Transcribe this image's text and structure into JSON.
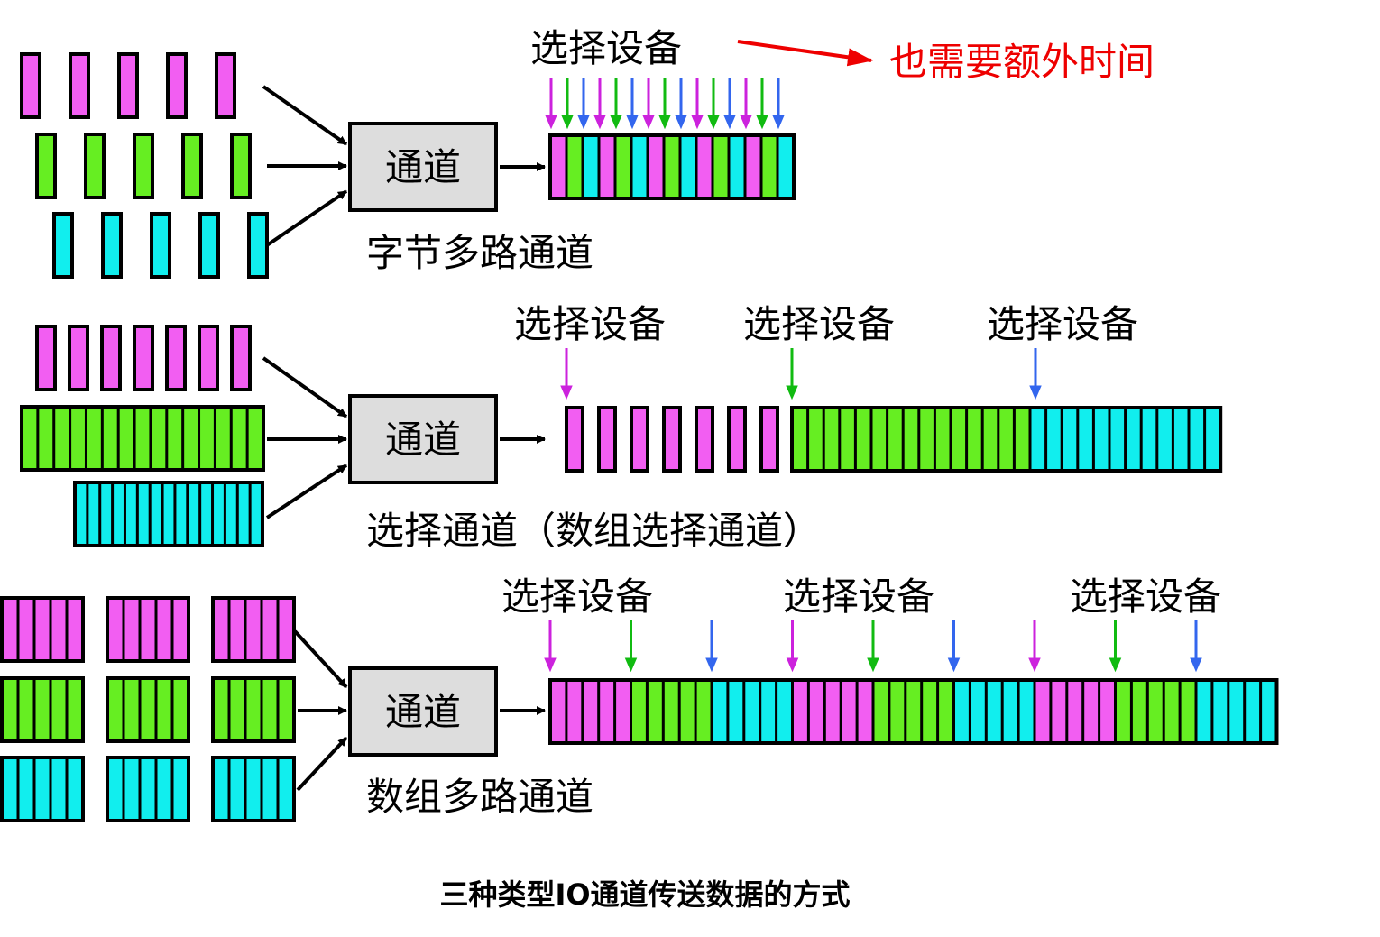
{
  "labels": {
    "select_device": "选择设备",
    "extra_time_note": "也需要额外时间",
    "channel": "通道",
    "byte_multiplex": "字节多路通道",
    "selector_channel": "选择通道（数组选择通道）",
    "block_multiplex": "数组多路通道",
    "caption": "三种类型IO通道传送数据的方式"
  },
  "colors": {
    "device_a": "#f25ef2",
    "device_b": "#66ee22",
    "device_c": "#11eeee",
    "arrow_a": "#cc22dd",
    "arrow_b": "#11bb11",
    "arrow_c": "#3366ee",
    "channel_box": "#dddddd",
    "note": "#ee0000"
  },
  "sections": [
    {
      "name": "byte-multiplex",
      "devices": 3,
      "sequence": "interleaved by byte",
      "select_points": 15
    },
    {
      "name": "selector",
      "devices": 3,
      "sequence": "one device at a time",
      "select_points": 3
    },
    {
      "name": "block-multiplex",
      "devices": 3,
      "sequence": "interleaved by block",
      "select_points": 9
    }
  ]
}
